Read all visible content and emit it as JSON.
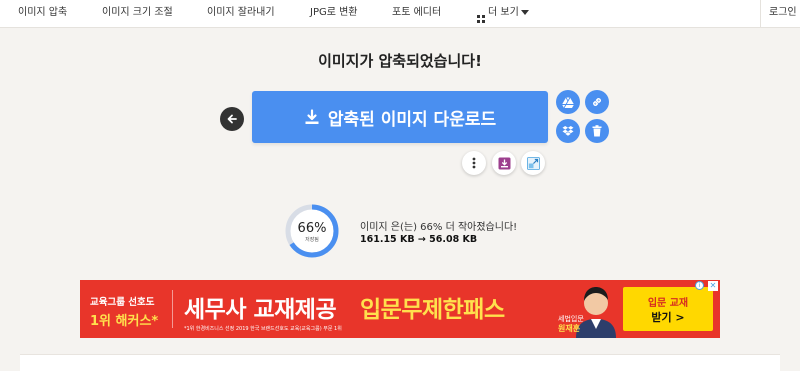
{
  "nav": {
    "items": [
      {
        "label": "이미지 압축"
      },
      {
        "label": "이미지 크기 조절"
      },
      {
        "label": "이미지 잘라내기"
      },
      {
        "label": "JPG로 변환"
      },
      {
        "label": "포토 에디터"
      },
      {
        "label": "더 보기"
      }
    ],
    "login": "로그인"
  },
  "main": {
    "title": "이미지가 압축되었습니다!",
    "download_label": "압축된 이미지 다운로드"
  },
  "result": {
    "percent": "66%",
    "percent_sub": "저장됨",
    "saved_fraction": 0.66,
    "message": "이미지 은(는) 66% 더 작아졌습니다!",
    "sizes": "161.15 KB → 56.08 KB"
  },
  "ad": {
    "left_line1": "교육그룹 선호도",
    "left_line2": "1위 해커스*",
    "headline_white": "세무사 교재제공",
    "headline_yellow": "입문무제한패스",
    "fine_print": "*1위 한경비즈니스 선정 2019 한국 브랜드선호도 교육(교육그룹) 부문 1위",
    "name_line1": "세법입문",
    "name_line2": "원재훈",
    "cta_line1": "입문 교재",
    "cta_line2": "받기 >"
  },
  "colors": {
    "accent": "#4a8ff0",
    "ad_red": "#e8352a",
    "ad_yellow": "#ffd800"
  },
  "icons": [
    "arrow-left-icon",
    "download-icon",
    "google-drive-icon",
    "link-icon",
    "dropbox-icon",
    "trash-icon",
    "more-vertical-icon",
    "save-icon",
    "resize-icon"
  ]
}
